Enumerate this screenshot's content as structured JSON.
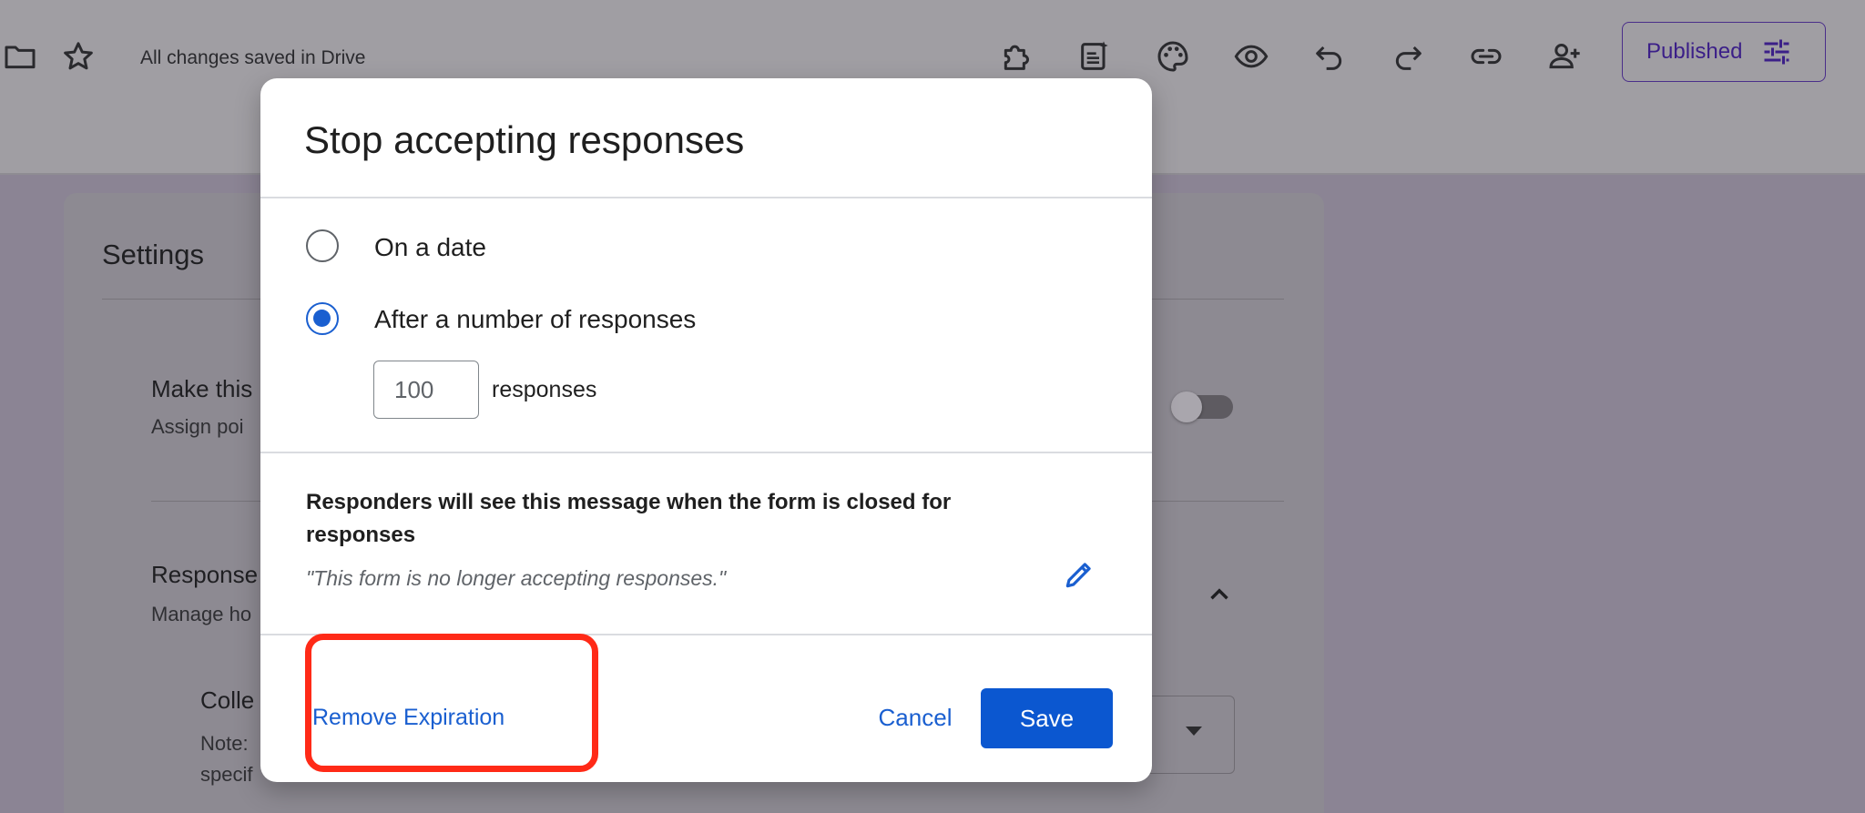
{
  "toolbar": {
    "saved_status": "All changes saved in Drive",
    "published_label": "Published",
    "icons": [
      "folder-icon",
      "star-icon",
      "addon-icon",
      "customize-form-icon",
      "palette-icon",
      "preview-icon",
      "undo-icon",
      "redo-icon",
      "link-icon",
      "add-collaborator-icon",
      "tune-icon"
    ]
  },
  "settings": {
    "title": "Settings",
    "quiz_label": "Make this",
    "quiz_sub": "Assign poi",
    "responses_label": "Response",
    "responses_sub": "Manage ho",
    "collect_label": "Colle",
    "collect_note": "Note:",
    "collect_note2": "specif",
    "quiz_toggle_on": false
  },
  "dialog": {
    "title": "Stop accepting responses",
    "option_date": "On a date",
    "option_count": "After a number of responses",
    "selected_option": "After a number of responses",
    "count_value": "100",
    "count_suffix": "responses",
    "message_heading": "Responders will see this message when the form is closed for responses",
    "message_text": "\"This form is no longer accepting responses.\"",
    "remove_label": "Remove Expiration",
    "cancel_label": "Cancel",
    "save_label": "Save"
  },
  "colors": {
    "accent": "#0b57d0",
    "link": "#1a5fd0",
    "highlight": "#ff2a17",
    "published": "#3b1f88"
  }
}
